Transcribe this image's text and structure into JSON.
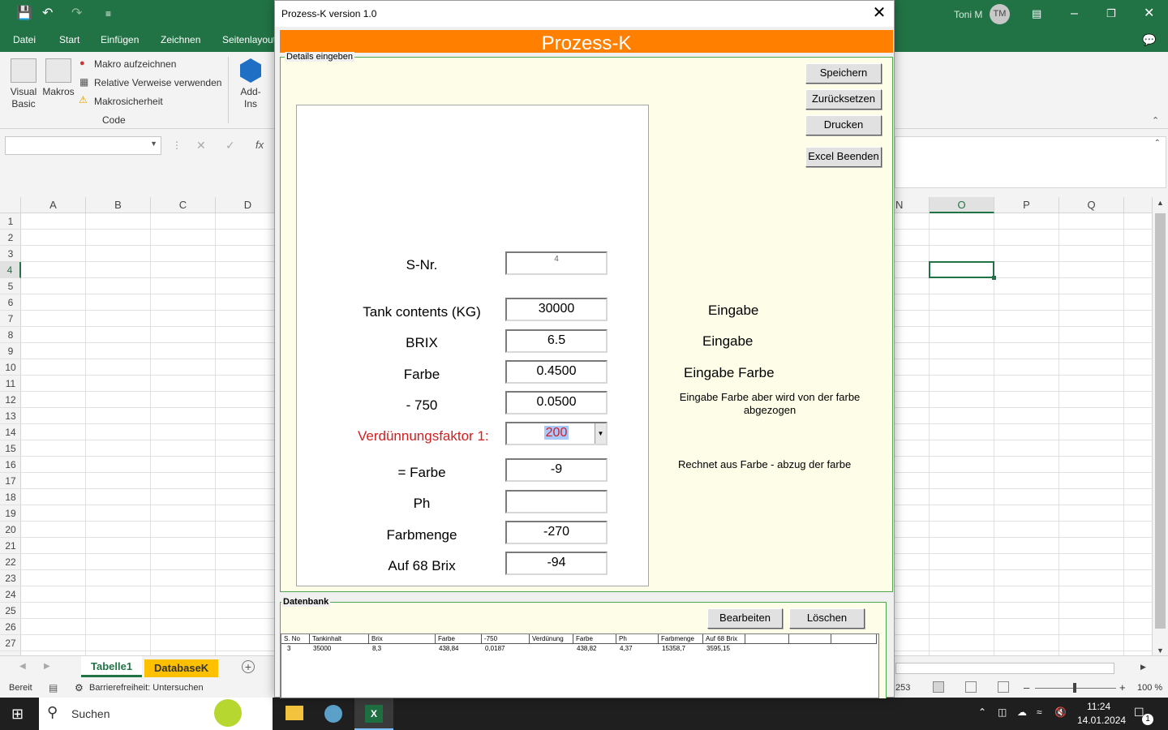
{
  "excel": {
    "user_name": "Toni M",
    "user_initials": "TM",
    "ribbon_tabs": [
      "Datei",
      "Start",
      "Einfügen",
      "Zeichnen",
      "Seitenlayout"
    ],
    "ribbon": {
      "visual_basic": "Visual Basic",
      "makros": "Makros",
      "makro_aufzeichnen": "Makro aufzeichnen",
      "relative_verweise": "Relative Verweise verwenden",
      "makrosicherheit": "Makrosicherheit",
      "code_group": "Code",
      "addins": "Add-Ins"
    },
    "columns_left": [
      "A",
      "B",
      "C",
      "D"
    ],
    "columns_right": [
      "N",
      "O",
      "P",
      "Q"
    ],
    "rows": [
      "1",
      "2",
      "3",
      "4",
      "5",
      "6",
      "7",
      "8",
      "9",
      "10",
      "11",
      "12",
      "13",
      "14",
      "15",
      "16",
      "17",
      "18",
      "19",
      "20",
      "21",
      "22",
      "23",
      "24",
      "25",
      "26",
      "27"
    ],
    "sheets": [
      "Tabelle1",
      "DatabaseK"
    ],
    "status_ready": "Bereit",
    "accessibility": "Barrierefreiheit: Untersuchen",
    "partial_count": "253",
    "zoom": "100 %"
  },
  "taskbar": {
    "search_placeholder": "Suchen",
    "time": "11:24",
    "date": "14.01.2024",
    "notification_count": "1"
  },
  "form": {
    "title": "Prozess-K version 1.0",
    "banner": "Prozess-K",
    "details_legend": "Details eingeben",
    "buttons": {
      "speichern": "Speichern",
      "zuruecksetzen": "Zurücksetzen",
      "drucken": "Drucken",
      "excel_beenden": "Excel Beenden"
    },
    "fields": {
      "snr": {
        "label": "S-Nr.",
        "value": "4"
      },
      "tank": {
        "label": "Tank contents (KG)",
        "value": "30000",
        "hint": "Eingabe"
      },
      "brix": {
        "label": "BRIX",
        "value": "6.5",
        "hint": "Eingabe"
      },
      "farbe": {
        "label": "Farbe",
        "value": "0.4500",
        "hint": "Eingabe Farbe"
      },
      "minus750": {
        "label": "- 750",
        "value": "0.0500",
        "hint": "Eingabe Farbe aber wird von der farbe abgezogen"
      },
      "verduennung": {
        "label": "Verdünnungsfaktor 1:",
        "value": "200"
      },
      "eq_farbe": {
        "label": "= Farbe",
        "value": "-9",
        "hint": "Rechnet aus Farbe - abzug der farbe"
      },
      "ph": {
        "label": "Ph",
        "value": ""
      },
      "farbmenge": {
        "label": "Farbmenge",
        "value": "-270"
      },
      "auf68": {
        "label": "Auf 68 Brix",
        "value": "-94"
      }
    },
    "datenbank": {
      "legend": "Datenbank",
      "bearbeiten": "Bearbeiten",
      "loeschen": "Löschen",
      "headers": [
        "S. No",
        "Tankinhalt",
        "Brix",
        "Farbe",
        "-750",
        "Verdünung",
        "Farbe",
        "Ph",
        "Farbmenge",
        "Auf 68 Brix"
      ],
      "rows": [
        [
          "3",
          "35000",
          "8,3",
          "438,84",
          "0,0187",
          "",
          "438,82",
          "4,37",
          "15358,7",
          "3595,15"
        ]
      ]
    }
  },
  "colors": {
    "excel_green": "#217346",
    "banner_orange": "#FF8000",
    "frame_bg": "#FEFEE8",
    "label_red": "#D02020"
  }
}
